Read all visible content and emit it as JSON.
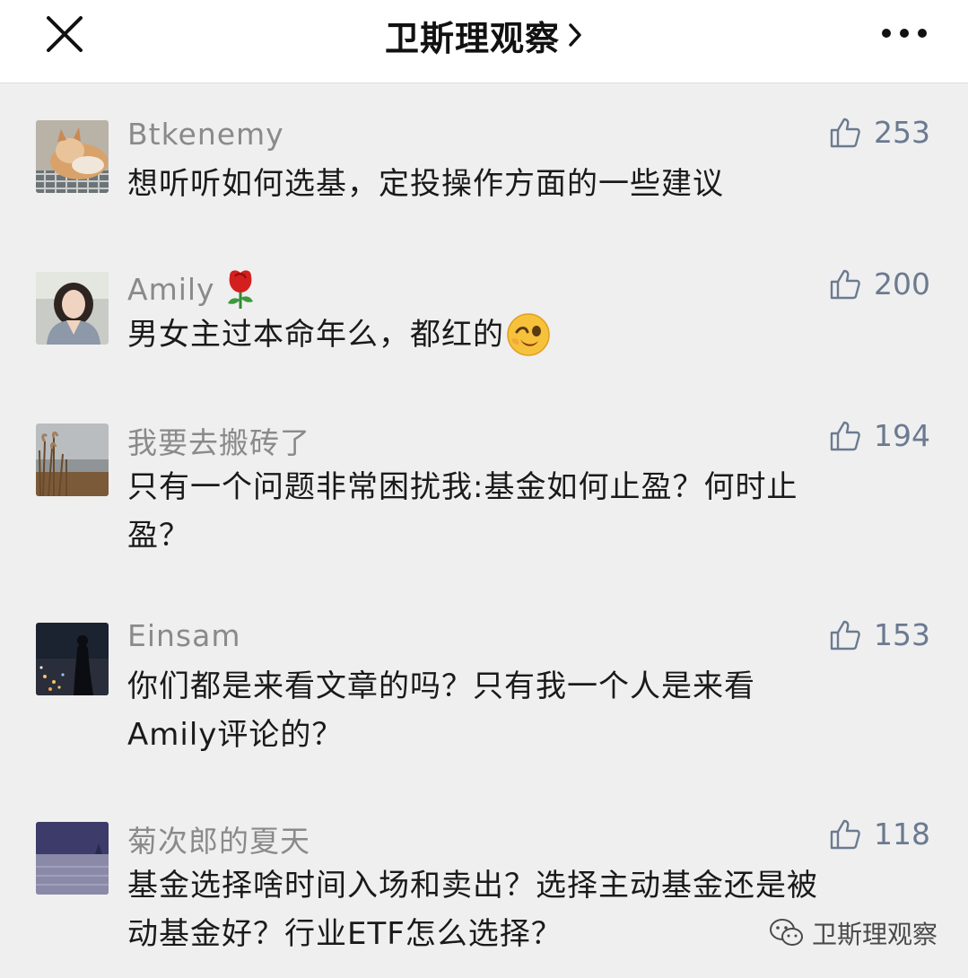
{
  "header": {
    "title": "卫斯理观察",
    "close_icon": "close-icon",
    "chevron_icon": "chevron-right-icon",
    "more_icon": "more-icon"
  },
  "comments": [
    {
      "nickname": "Btkenemy",
      "likes": "253",
      "text": "想听听如何选基，定投操作方面的一些建议",
      "avatar": "cat-avatar"
    },
    {
      "nickname": "Amily",
      "emoji": "rose",
      "likes": "200",
      "text": "男女主过本命年么，都红的",
      "text_emoji": "winking-face",
      "avatar": "woman-avatar"
    },
    {
      "nickname": "我要去搬砖了",
      "likes": "194",
      "text_line1": "只有一个问题非常困扰我:基金如何止盈？何时止",
      "text_line2": "盈？",
      "avatar": "reeds-avatar"
    },
    {
      "nickname": "Einsam",
      "likes": "153",
      "text_line1": "你们都是来看文章的吗？只有我一个人是来看",
      "text_line2": "Amily评论的？",
      "avatar": "city-night-avatar"
    },
    {
      "nickname": "菊次郎的夏天",
      "likes": "118",
      "text_line1": "基金选择啥时间入场和卖出？选择主动基金还是被",
      "text_line2": "动基金好？行业ETF怎么选择？",
      "avatar": "sea-avatar"
    }
  ],
  "watermark": {
    "text": "卫斯理观察",
    "icon": "wechat-icon"
  },
  "colors": {
    "like": "#6b7a90",
    "nickname": "#8a8a8a",
    "background": "#efefef"
  }
}
